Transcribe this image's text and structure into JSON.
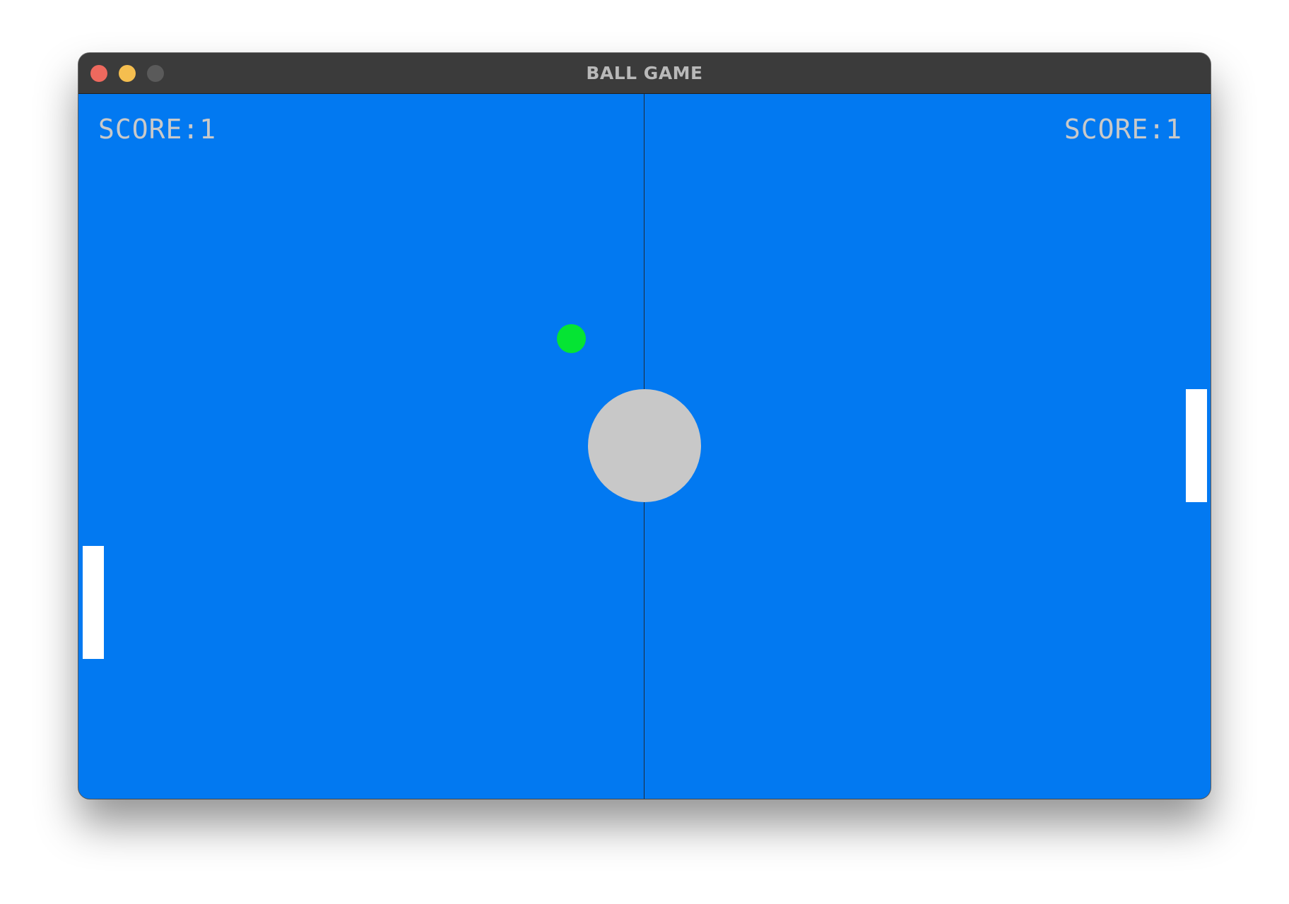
{
  "window": {
    "title": "BALL GAME"
  },
  "scores": {
    "left_label": "SCORE:1",
    "right_label": "SCORE:1",
    "left_value": 1,
    "right_value": 1
  },
  "colors": {
    "field": "#0279f1",
    "ball": "#05e433",
    "center_circle": "#c8c8c8",
    "paddles": "#ffffff",
    "score_text": "#c9c9c9",
    "center_line": "#1d2b3a"
  }
}
